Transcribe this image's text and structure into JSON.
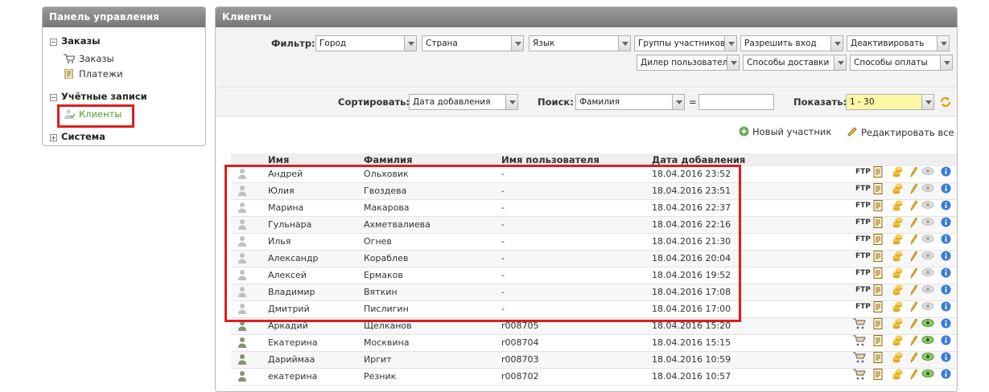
{
  "sidebar": {
    "title": "Панель управления",
    "sections": [
      {
        "label": "Заказы",
        "sign": "−",
        "items": [
          {
            "label": "Заказы",
            "icon": "cart-icon"
          },
          {
            "label": "Платежи",
            "icon": "document-icon"
          }
        ]
      },
      {
        "label": "Учётные записи",
        "sign": "−",
        "items": [
          {
            "label": "Клиенты",
            "icon": "user-icon",
            "active": true
          }
        ]
      },
      {
        "label": "Система",
        "sign": "+",
        "items": []
      }
    ]
  },
  "main": {
    "title": "Клиенты",
    "filter": {
      "label": "Фильтр:",
      "dropdowns": [
        "Город",
        "Страна",
        "Язык",
        "Группы участников",
        "Разрешить вход",
        "Деактивировать",
        "Дилер пользователя",
        "Способы доставки",
        "Способы оплаты"
      ]
    },
    "sort": {
      "label": "Сортировать:",
      "value": "Дата добавления"
    },
    "search": {
      "label": "Поиск:",
      "field": "Фамилия",
      "eq": "=",
      "value": ""
    },
    "show": {
      "label": "Показать:",
      "value": "1 - 30"
    },
    "actions": {
      "new_member": "Новый участник",
      "edit_all": "Редактировать все"
    },
    "table": {
      "columns": [
        "Имя",
        "Фамилия",
        "Имя пользователя",
        "Дата добавления"
      ],
      "rows": [
        {
          "first": "Андрей",
          "last": "Ольховик",
          "user": "-",
          "date": "18.04.2016 23:52",
          "type": "ftp"
        },
        {
          "first": "Юлия",
          "last": "Гвоздева",
          "user": "-",
          "date": "18.04.2016 23:51",
          "type": "ftp"
        },
        {
          "first": "Марина",
          "last": "Макарова",
          "user": "-",
          "date": "18.04.2016 22:37",
          "type": "ftp"
        },
        {
          "first": "Гульнара",
          "last": "Ахметвалиева",
          "user": "-",
          "date": "18.04.2016 22:16",
          "type": "ftp"
        },
        {
          "first": "Илья",
          "last": "Огнев",
          "user": "-",
          "date": "18.04.2016 21:30",
          "type": "ftp"
        },
        {
          "first": "Александр",
          "last": "Кораблев",
          "user": "-",
          "date": "18.04.2016 20:04",
          "type": "ftp"
        },
        {
          "first": "Алексей",
          "last": "Ермаков",
          "user": "-",
          "date": "18.04.2016 19:52",
          "type": "ftp"
        },
        {
          "first": "Владимир",
          "last": "Вяткин",
          "user": "-",
          "date": "18.04.2016 17:08",
          "type": "ftp"
        },
        {
          "first": "Дмитрий",
          "last": "Пислигин",
          "user": "-",
          "date": "18.04.2016 17:00",
          "type": "ftp"
        },
        {
          "first": "Аркадий",
          "last": "Щелканов",
          "user": "r008705",
          "date": "18.04.2016 15:20",
          "type": "cart"
        },
        {
          "first": "Екатерина",
          "last": "Москвина",
          "user": "r008704",
          "date": "18.04.2016 15:15",
          "type": "cart"
        },
        {
          "first": "Дариймаа",
          "last": "Иргит",
          "user": "r008703",
          "date": "18.04.2016 10:59",
          "type": "cart"
        },
        {
          "first": "екатерина",
          "last": "Резник",
          "user": "r008702",
          "date": "18.04.2016 10:57",
          "type": "cart"
        }
      ]
    }
  },
  "colors": {
    "header": "#8a8a8a",
    "highlight": "#e21c1c",
    "active_link": "#5a9a2a",
    "show_bg": "#fdf7a6"
  }
}
